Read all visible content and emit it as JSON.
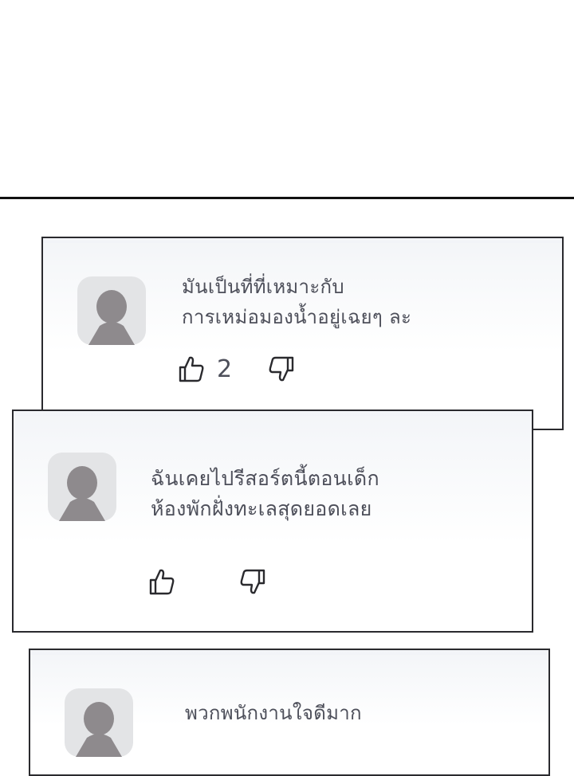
{
  "comments": [
    {
      "lines": [
        "มันเป็นที่ที่เหมาะกับ",
        "การเหม่อมองน้ำอยู่เฉยๆ ละ"
      ],
      "likes": "2",
      "like_icon": "thumbs-up-icon",
      "dislike_icon": "thumbs-down-icon"
    },
    {
      "lines": [
        "ฉันเคยไปรีสอร์ตนี้ตอนเด็ก",
        "ห้องพักฝั่งทะเลสุดยอดเลย"
      ],
      "like_icon": "thumbs-up-icon",
      "dislike_icon": "thumbs-down-icon"
    },
    {
      "lines": [
        "พวกพนักงานใจดีมาก"
      ],
      "like_icon": "thumbs-up-icon",
      "dislike_icon": "thumbs-down-icon"
    }
  ],
  "colors": {
    "avatar_bg": "#e3e4e6",
    "avatar_figure": "#8e8a8d",
    "text": "#4d4f5a",
    "border": "#2a2a2e"
  }
}
